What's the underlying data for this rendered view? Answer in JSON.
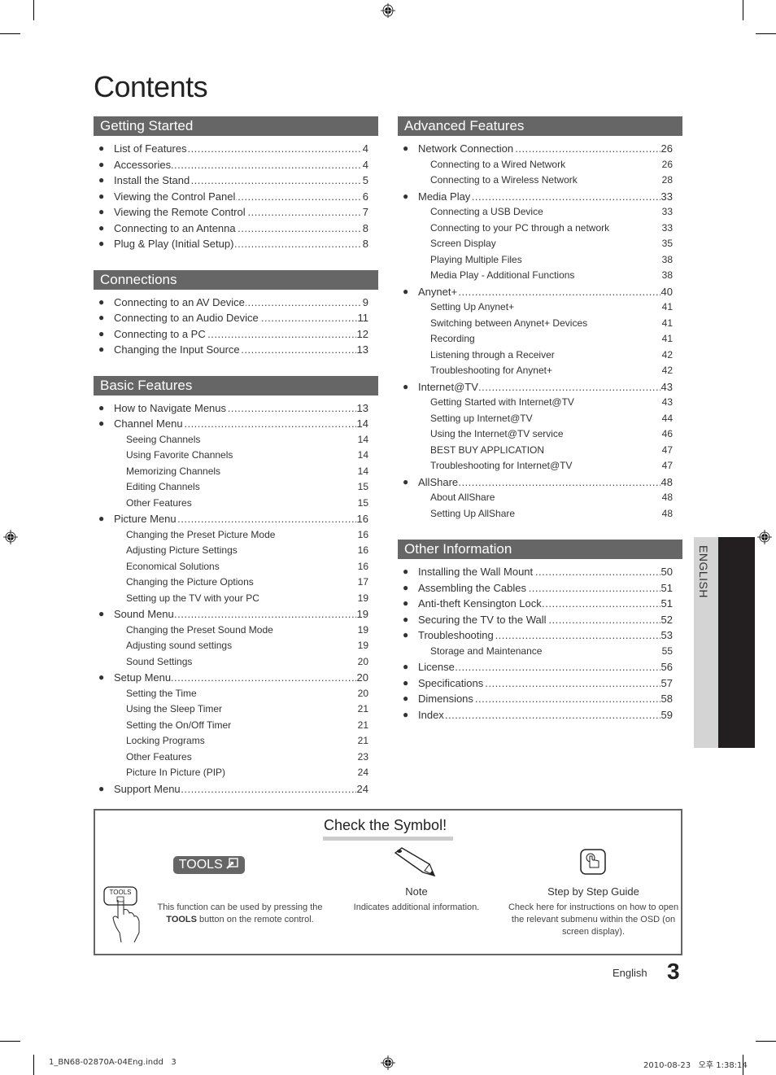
{
  "title": "Contents",
  "left_column": [
    {
      "header": "Getting Started",
      "entries": [
        {
          "label": "List of Features",
          "page": "4",
          "level": 1
        },
        {
          "label": "Accessories",
          "page": "4",
          "level": 1
        },
        {
          "label": "Install the Stand",
          "page": "5",
          "level": 1
        },
        {
          "label": "Viewing the Control Panel",
          "page": "6",
          "level": 1
        },
        {
          "label": "Viewing the Remote Control",
          "page": "7",
          "level": 1
        },
        {
          "label": "Connecting to an Antenna",
          "page": "8",
          "level": 1
        },
        {
          "label": "Plug & Play (Initial Setup)",
          "page": "8",
          "level": 1
        }
      ]
    },
    {
      "header": "Connections",
      "entries": [
        {
          "label": "Connecting to an AV Device",
          "page": "9",
          "level": 1
        },
        {
          "label": "Connecting to an Audio Device",
          "page": "11",
          "level": 1
        },
        {
          "label": "Connecting to a PC",
          "page": "12",
          "level": 1
        },
        {
          "label": "Changing the Input Source",
          "page": "13",
          "level": 1
        }
      ]
    },
    {
      "header": "Basic Features",
      "entries": [
        {
          "label": "How to Navigate Menus",
          "page": "13",
          "level": 1
        },
        {
          "label": "Channel Menu",
          "page": "14",
          "level": 1
        },
        {
          "label": "Seeing Channels",
          "page": "14",
          "level": 2
        },
        {
          "label": "Using Favorite Channels",
          "page": "14",
          "level": 2
        },
        {
          "label": "Memorizing Channels",
          "page": "14",
          "level": 2
        },
        {
          "label": "Editing Channels",
          "page": "15",
          "level": 2
        },
        {
          "label": "Other Features",
          "page": "15",
          "level": 2
        },
        {
          "label": "Picture Menu",
          "page": "16",
          "level": 1
        },
        {
          "label": "Changing the Preset Picture Mode",
          "page": "16",
          "level": 2
        },
        {
          "label": "Adjusting Picture Settings",
          "page": "16",
          "level": 2
        },
        {
          "label": "Economical Solutions",
          "page": "16",
          "level": 2
        },
        {
          "label": "Changing the Picture Options",
          "page": "17",
          "level": 2
        },
        {
          "label": "Setting up the TV with your PC",
          "page": "19",
          "level": 2
        },
        {
          "label": "Sound Menu",
          "page": "19",
          "level": 1
        },
        {
          "label": "Changing the Preset Sound Mode",
          "page": "19",
          "level": 2
        },
        {
          "label": "Adjusting sound settings",
          "page": "19",
          "level": 2
        },
        {
          "label": "Sound Settings",
          "page": "20",
          "level": 2
        },
        {
          "label": "Setup Menu",
          "page": "20",
          "level": 1
        },
        {
          "label": "Setting the Time",
          "page": "20",
          "level": 2
        },
        {
          "label": "Using the Sleep Timer",
          "page": "21",
          "level": 2
        },
        {
          "label": "Setting the On/Off Timer",
          "page": "21",
          "level": 2
        },
        {
          "label": "Locking Programs",
          "page": "21",
          "level": 2
        },
        {
          "label": "Other Features",
          "page": "23",
          "level": 2
        },
        {
          "label": "Picture In Picture (PIP)",
          "page": "24",
          "level": 2
        },
        {
          "label": "Support Menu",
          "page": "24",
          "level": 1
        }
      ]
    }
  ],
  "right_column": [
    {
      "header": "Advanced Features",
      "entries": [
        {
          "label": "Network Connection",
          "page": "26",
          "level": 1
        },
        {
          "label": "Connecting to a Wired Network",
          "page": "26",
          "level": 2
        },
        {
          "label": "Connecting to a Wireless Network",
          "page": "28",
          "level": 2
        },
        {
          "label": "Media Play",
          "page": "33",
          "level": 1
        },
        {
          "label": "Connecting a USB Device",
          "page": "33",
          "level": 2
        },
        {
          "label": "Connecting to your PC through a network",
          "page": "33",
          "level": 2
        },
        {
          "label": "Screen Display",
          "page": "35",
          "level": 2
        },
        {
          "label": "Playing Multiple Files",
          "page": "38",
          "level": 2
        },
        {
          "label": "Media Play - Additional Functions",
          "page": "38",
          "level": 2
        },
        {
          "label": "Anynet+",
          "page": "40",
          "level": 1
        },
        {
          "label": "Setting Up Anynet+",
          "page": "41",
          "level": 2
        },
        {
          "label": "Switching between Anynet+ Devices",
          "page": "41",
          "level": 2
        },
        {
          "label": "Recording",
          "page": "41",
          "level": 2
        },
        {
          "label": "Listening through a Receiver",
          "page": "42",
          "level": 2
        },
        {
          "label": "Troubleshooting for Anynet+",
          "page": "42",
          "level": 2
        },
        {
          "label": "Internet@TV",
          "page": "43",
          "level": 1
        },
        {
          "label": "Getting Started with Internet@TV",
          "page": "43",
          "level": 2
        },
        {
          "label": "Setting up Internet@TV",
          "page": "44",
          "level": 2
        },
        {
          "label": "Using the Internet@TV service",
          "page": "46",
          "level": 2
        },
        {
          "label": "BEST BUY APPLICATION",
          "page": "47",
          "level": 2
        },
        {
          "label": "Troubleshooting for Internet@TV",
          "page": "47",
          "level": 2
        },
        {
          "label": "AllShare",
          "page": "48",
          "level": 1
        },
        {
          "label": "About AllShare",
          "page": "48",
          "level": 2
        },
        {
          "label": "Setting Up AllShare",
          "page": "48",
          "level": 2
        }
      ]
    },
    {
      "header": "Other Information",
      "entries": [
        {
          "label": "Installing the Wall Mount",
          "page": "50",
          "level": 1
        },
        {
          "label": "Assembling the Cables",
          "page": "51",
          "level": 1
        },
        {
          "label": "Anti-theft Kensington Lock",
          "page": "51",
          "level": 1
        },
        {
          "label": "Securing the TV to the Wall",
          "page": "52",
          "level": 1
        },
        {
          "label": "Troubleshooting",
          "page": "53",
          "level": 1
        },
        {
          "label": "Storage and Maintenance",
          "page": "55",
          "level": 2
        },
        {
          "label": "License",
          "page": "56",
          "level": 1
        },
        {
          "label": "Specifications",
          "page": "57",
          "level": 1
        },
        {
          "label": "Dimensions",
          "page": "58",
          "level": 1
        },
        {
          "label": "Index",
          "page": "59",
          "level": 1
        }
      ]
    }
  ],
  "side_tab": "ENGLISH",
  "symbols": {
    "title": "Check the Symbol!",
    "tools": {
      "badge": "TOOLS",
      "remote_button": "TOOLS",
      "description_line1": "This function can be used by pressing the",
      "description_line2_bold": "TOOLS",
      "description_line2_rest": " button on the remote control."
    },
    "note": {
      "name": "Note",
      "description": "Indicates additional information."
    },
    "guide": {
      "name": "Step by Step Guide",
      "description": "Check here for instructions on how to open the relevant submenu within the OSD (on screen display)."
    }
  },
  "footer": {
    "language": "English",
    "page_number": "3"
  },
  "slug": {
    "file": "1_BN68-02870A-04Eng.indd   3",
    "timestamp": "2010-08-23   오후 1:38:14"
  },
  "colors": {
    "header_bg": "#666666",
    "tab_light": "#d4d4d4",
    "tab_dark": "#231f20"
  }
}
